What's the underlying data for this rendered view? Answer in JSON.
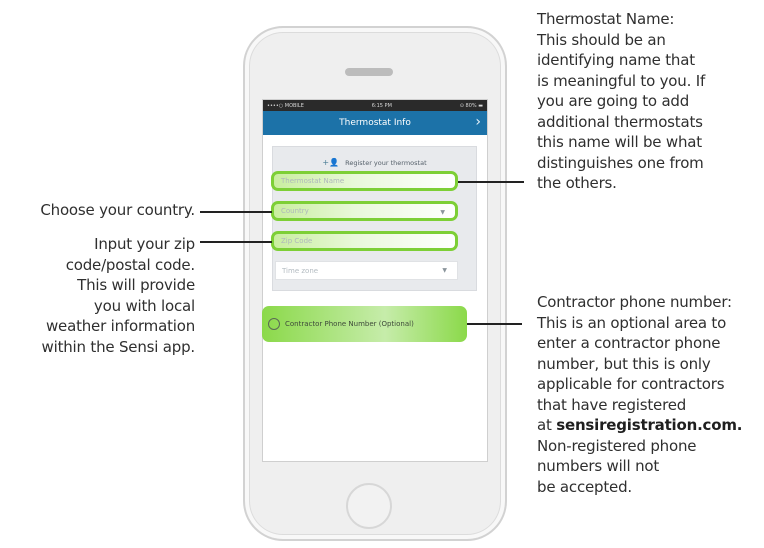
{
  "phone": {
    "status_left": "••••○ MOBILE",
    "status_time": "6:15 PM",
    "status_right": "⊙ 80% ▬",
    "nav_title": "Thermostat Info",
    "nav_chevron": "›",
    "register_label": "Register your thermostat",
    "register_icon": "+👤",
    "fields": {
      "name_placeholder": "Thermostat Name",
      "country_placeholder": "Country",
      "zip_placeholder": "Zip Code",
      "timezone_placeholder": "Time zone",
      "dropdown_arrow": "▼"
    },
    "contractor_label": "Contractor Phone Number (Optional)"
  },
  "annotations": {
    "country": "Choose your country.",
    "zip": [
      "Input your zip",
      "code/postal code.",
      "This will provide",
      "you with local",
      "weather information",
      "within the Sensi app."
    ],
    "name": [
      "Thermostat Name:",
      "This should be an",
      "identifying name that",
      "is meaningful to you. If",
      "you are going to add",
      "additional thermostats",
      "this name will be what",
      "distinguishes one from",
      "the others."
    ],
    "contractor": [
      "Contractor phone number:",
      "This is an optional area to",
      "enter a contractor phone",
      "number, but this is only",
      "applicable for contractors",
      "that have registered"
    ],
    "contractor_at": "at ",
    "contractor_link": "sensiregistration.com.",
    "contractor_tail": [
      "Non-registered phone",
      "numbers will not",
      "be accepted."
    ]
  }
}
